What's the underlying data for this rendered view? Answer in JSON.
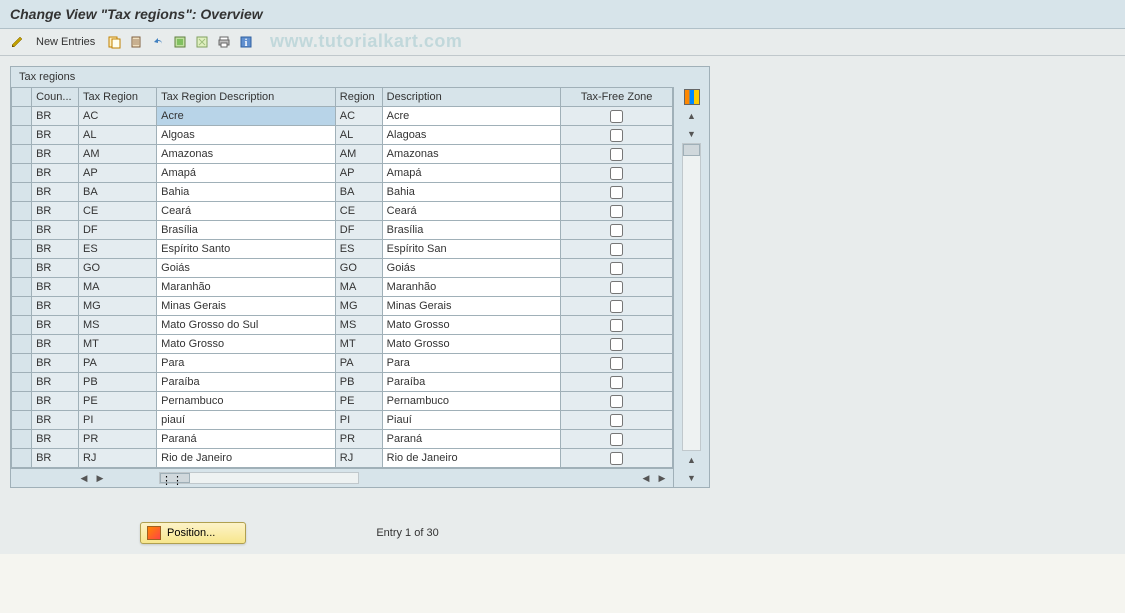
{
  "title": "Change View \"Tax regions\": Overview",
  "watermark": "www.tutorialkart.com",
  "toolbar": {
    "new_entries": "New Entries"
  },
  "table": {
    "title": "Tax regions",
    "headers": {
      "country": "Coun...",
      "tax_region": "Tax Region",
      "tax_region_desc": "Tax Region Description",
      "region": "Region",
      "description": "Description",
      "tax_free": "Tax-Free Zone"
    },
    "rows": [
      {
        "country": "BR",
        "tax_region": "AC",
        "tax_desc": "Acre",
        "region": "AC",
        "desc": "Acre",
        "tax_free": false,
        "selected": true
      },
      {
        "country": "BR",
        "tax_region": "AL",
        "tax_desc": "Algoas",
        "region": "AL",
        "desc": "Alagoas",
        "tax_free": false
      },
      {
        "country": "BR",
        "tax_region": "AM",
        "tax_desc": "Amazonas",
        "region": "AM",
        "desc": "Amazonas",
        "tax_free": false
      },
      {
        "country": "BR",
        "tax_region": "AP",
        "tax_desc": "Amapá",
        "region": "AP",
        "desc": "Amapá",
        "tax_free": false
      },
      {
        "country": "BR",
        "tax_region": "BA",
        "tax_desc": "Bahia",
        "region": "BA",
        "desc": "Bahia",
        "tax_free": false
      },
      {
        "country": "BR",
        "tax_region": "CE",
        "tax_desc": "Ceará",
        "region": "CE",
        "desc": "Ceará",
        "tax_free": false
      },
      {
        "country": "BR",
        "tax_region": "DF",
        "tax_desc": "Brasília",
        "region": "DF",
        "desc": "Brasília",
        "tax_free": false
      },
      {
        "country": "BR",
        "tax_region": "ES",
        "tax_desc": "Espírito Santo",
        "region": "ES",
        "desc": "Espírito San",
        "tax_free": false
      },
      {
        "country": "BR",
        "tax_region": "GO",
        "tax_desc": "Goiás",
        "region": "GO",
        "desc": "Goiás",
        "tax_free": false
      },
      {
        "country": "BR",
        "tax_region": "MA",
        "tax_desc": "Maranhão",
        "region": "MA",
        "desc": "Maranhão",
        "tax_free": false
      },
      {
        "country": "BR",
        "tax_region": "MG",
        "tax_desc": "Minas Gerais",
        "region": "MG",
        "desc": "Minas Gerais",
        "tax_free": false
      },
      {
        "country": "BR",
        "tax_region": "MS",
        "tax_desc": "Mato Grosso do Sul",
        "region": "MS",
        "desc": "Mato Grosso",
        "tax_free": false
      },
      {
        "country": "BR",
        "tax_region": "MT",
        "tax_desc": "Mato Grosso",
        "region": "MT",
        "desc": "Mato Grosso",
        "tax_free": false
      },
      {
        "country": "BR",
        "tax_region": "PA",
        "tax_desc": "Para",
        "region": "PA",
        "desc": "Para",
        "tax_free": false
      },
      {
        "country": "BR",
        "tax_region": "PB",
        "tax_desc": "Paraíba",
        "region": "PB",
        "desc": "Paraíba",
        "tax_free": false
      },
      {
        "country": "BR",
        "tax_region": "PE",
        "tax_desc": "Pernambuco",
        "region": "PE",
        "desc": "Pernambuco",
        "tax_free": false
      },
      {
        "country": "BR",
        "tax_region": "PI",
        "tax_desc": "piauí",
        "region": "PI",
        "desc": "Piauí",
        "tax_free": false
      },
      {
        "country": "BR",
        "tax_region": "PR",
        "tax_desc": "Paraná",
        "region": "PR",
        "desc": "Paraná",
        "tax_free": false
      },
      {
        "country": "BR",
        "tax_region": "RJ",
        "tax_desc": "Rio de Janeiro",
        "region": "RJ",
        "desc": "Rio de Janeiro",
        "tax_free": false
      }
    ]
  },
  "footer": {
    "position_label": "Position...",
    "entry_info": "Entry 1 of 30"
  }
}
